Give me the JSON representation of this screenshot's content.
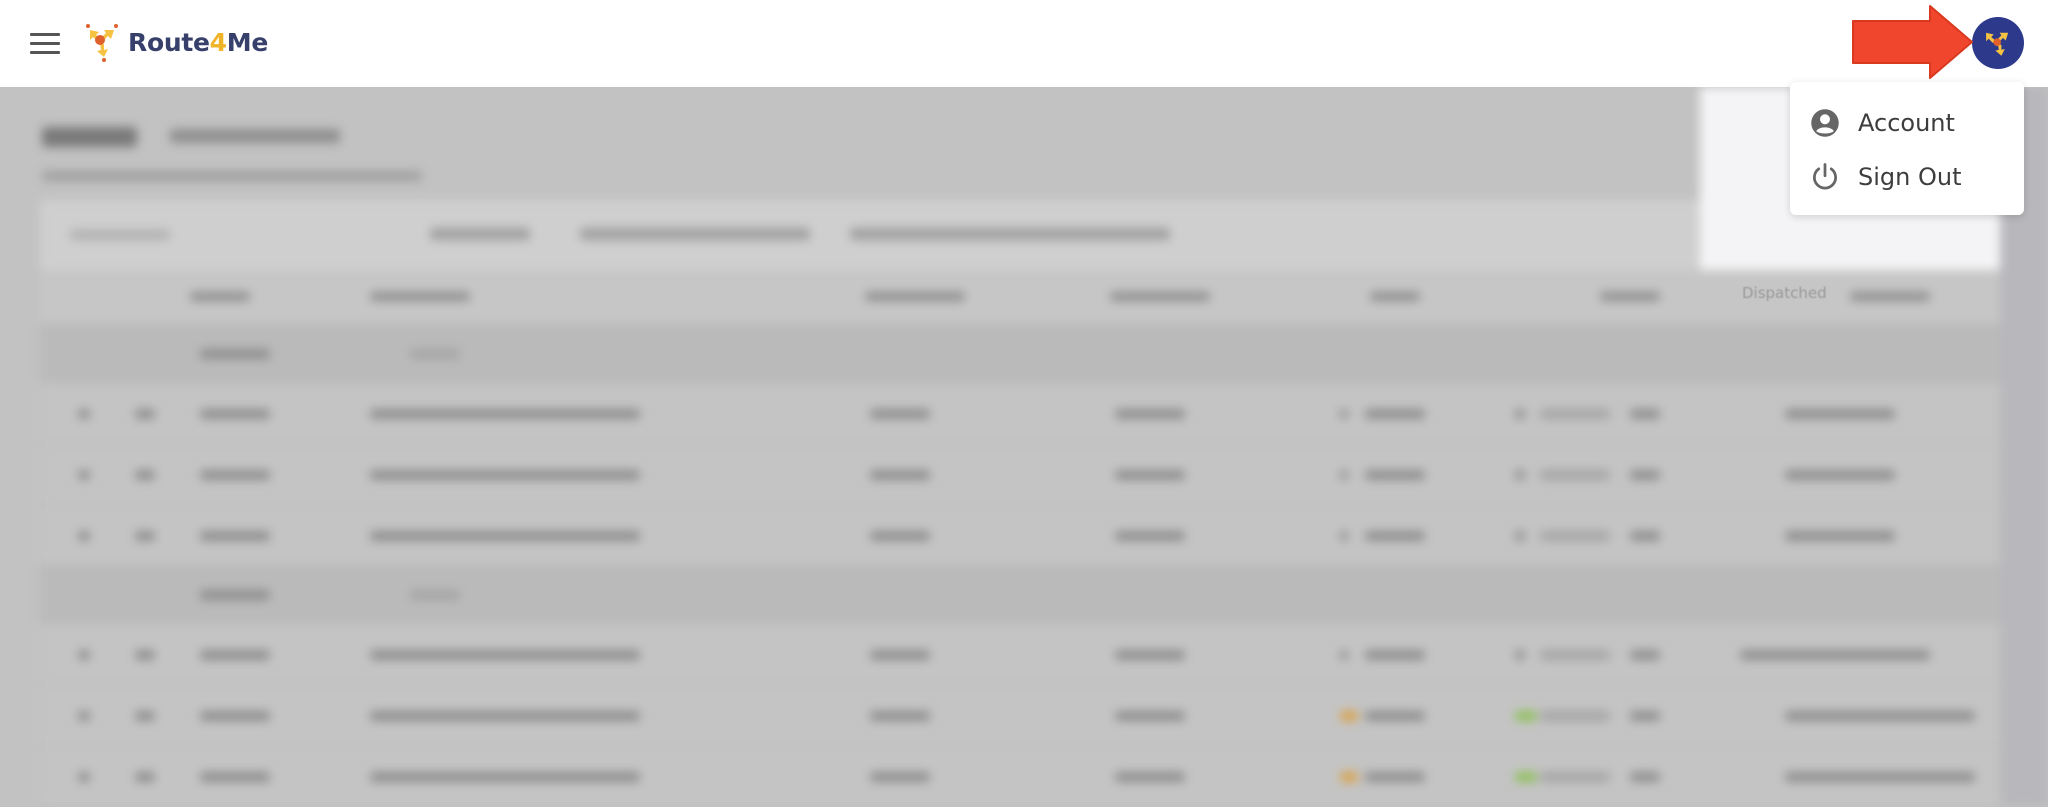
{
  "header": {
    "menu_icon": "hamburger-icon",
    "logo": {
      "text_main": "Route",
      "text_accent": "4",
      "text_end": "Me"
    },
    "avatar_icon": "route4me-logo-icon"
  },
  "annotation": {
    "arrow_color": "#f0462d"
  },
  "user_menu": {
    "items": [
      {
        "label": "Account",
        "icon": "account-circle-icon"
      },
      {
        "label": "Sign Out",
        "icon": "power-icon"
      }
    ]
  },
  "background": {
    "visible_column_header": "Dispatched"
  },
  "colors": {
    "brand_navy": "#2d3a8c",
    "brand_yellow": "#f0b429",
    "overlay": "#c2c2c2"
  }
}
